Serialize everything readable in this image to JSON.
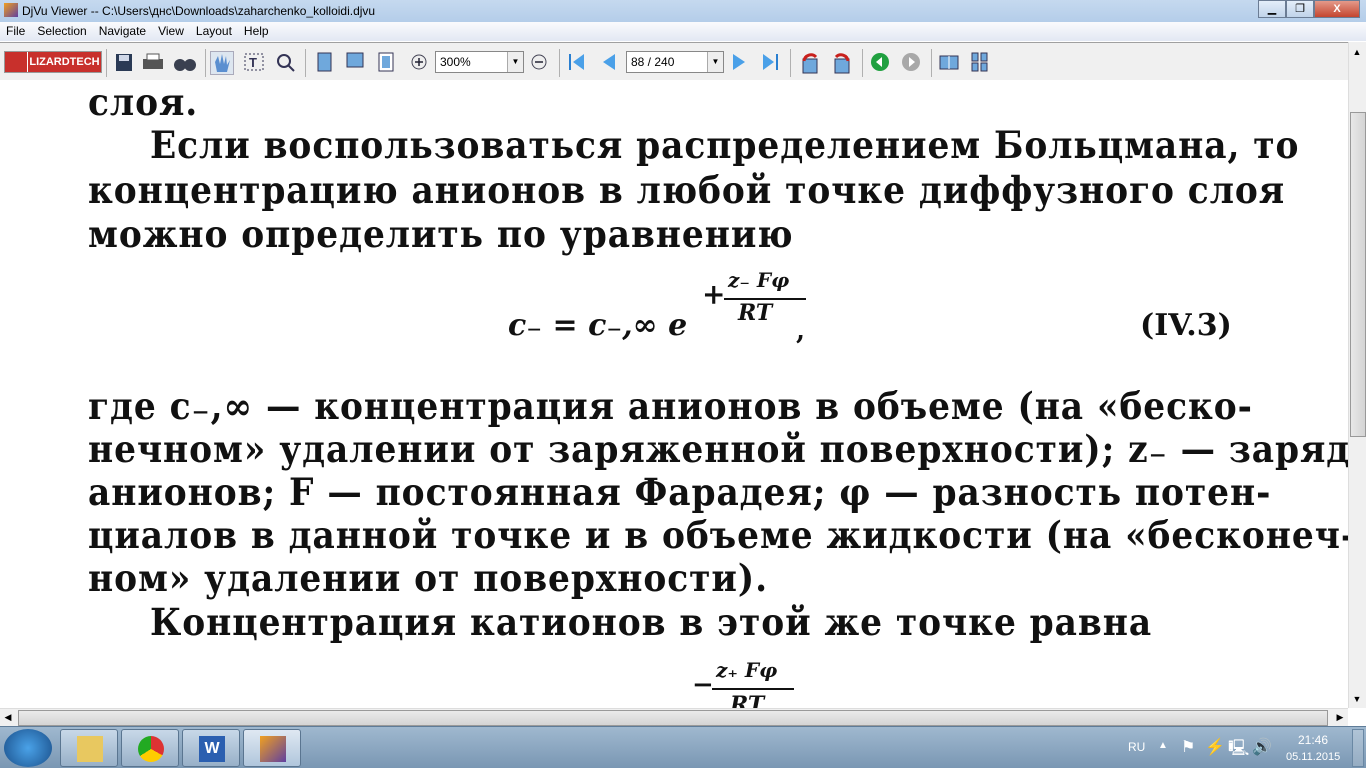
{
  "window": {
    "title": "DjVu Viewer -- C:\\Users\\днс\\Downloads\\zaharchenko_kolloidi.djvu",
    "minimize": "▁",
    "restore": "❐",
    "close": "X"
  },
  "menu": [
    "File",
    "Selection",
    "Navigate",
    "View",
    "Layout",
    "Help"
  ],
  "toolbar": {
    "logo": "LIZARDTECH",
    "zoom": "300%",
    "page": "88 / 240"
  },
  "doc": {
    "lines_top": [
      "слоя.",
      "Если воспользоваться распределением Больцмана, то",
      "концентрацию анионов в любой точке диффузного слоя",
      "можно определить по уравнению"
    ],
    "eq1": {
      "lhs": "c₋ = c₋,∞ e",
      "sign": "+",
      "num": "z₋ Fφ",
      "den": "RT",
      "comma": ",",
      "label": "(IV.3)"
    },
    "lines_mid": [
      "где c₋,∞ — концентрация анионов в объеме (на «беско-",
      "нечном» удалении от заряженной поверхности); z₋ — заряд",
      "анионов; F — постоянная Фарадея; φ — разность потен-",
      "циалов в данной точке и в объеме жидкости (на «бесконеч-",
      "ном» удалении от поверхности).",
      "Концентрация катионов в этой же точке равна"
    ],
    "eq2": {
      "sign": "−",
      "num": "z₊ Fφ",
      "den": "RT"
    }
  },
  "taskbar": {
    "lang": "RU",
    "time": "21:46",
    "date": "05.11.2015",
    "apps": [
      "explorer",
      "chrome",
      "word",
      "djvu-viewer"
    ]
  }
}
